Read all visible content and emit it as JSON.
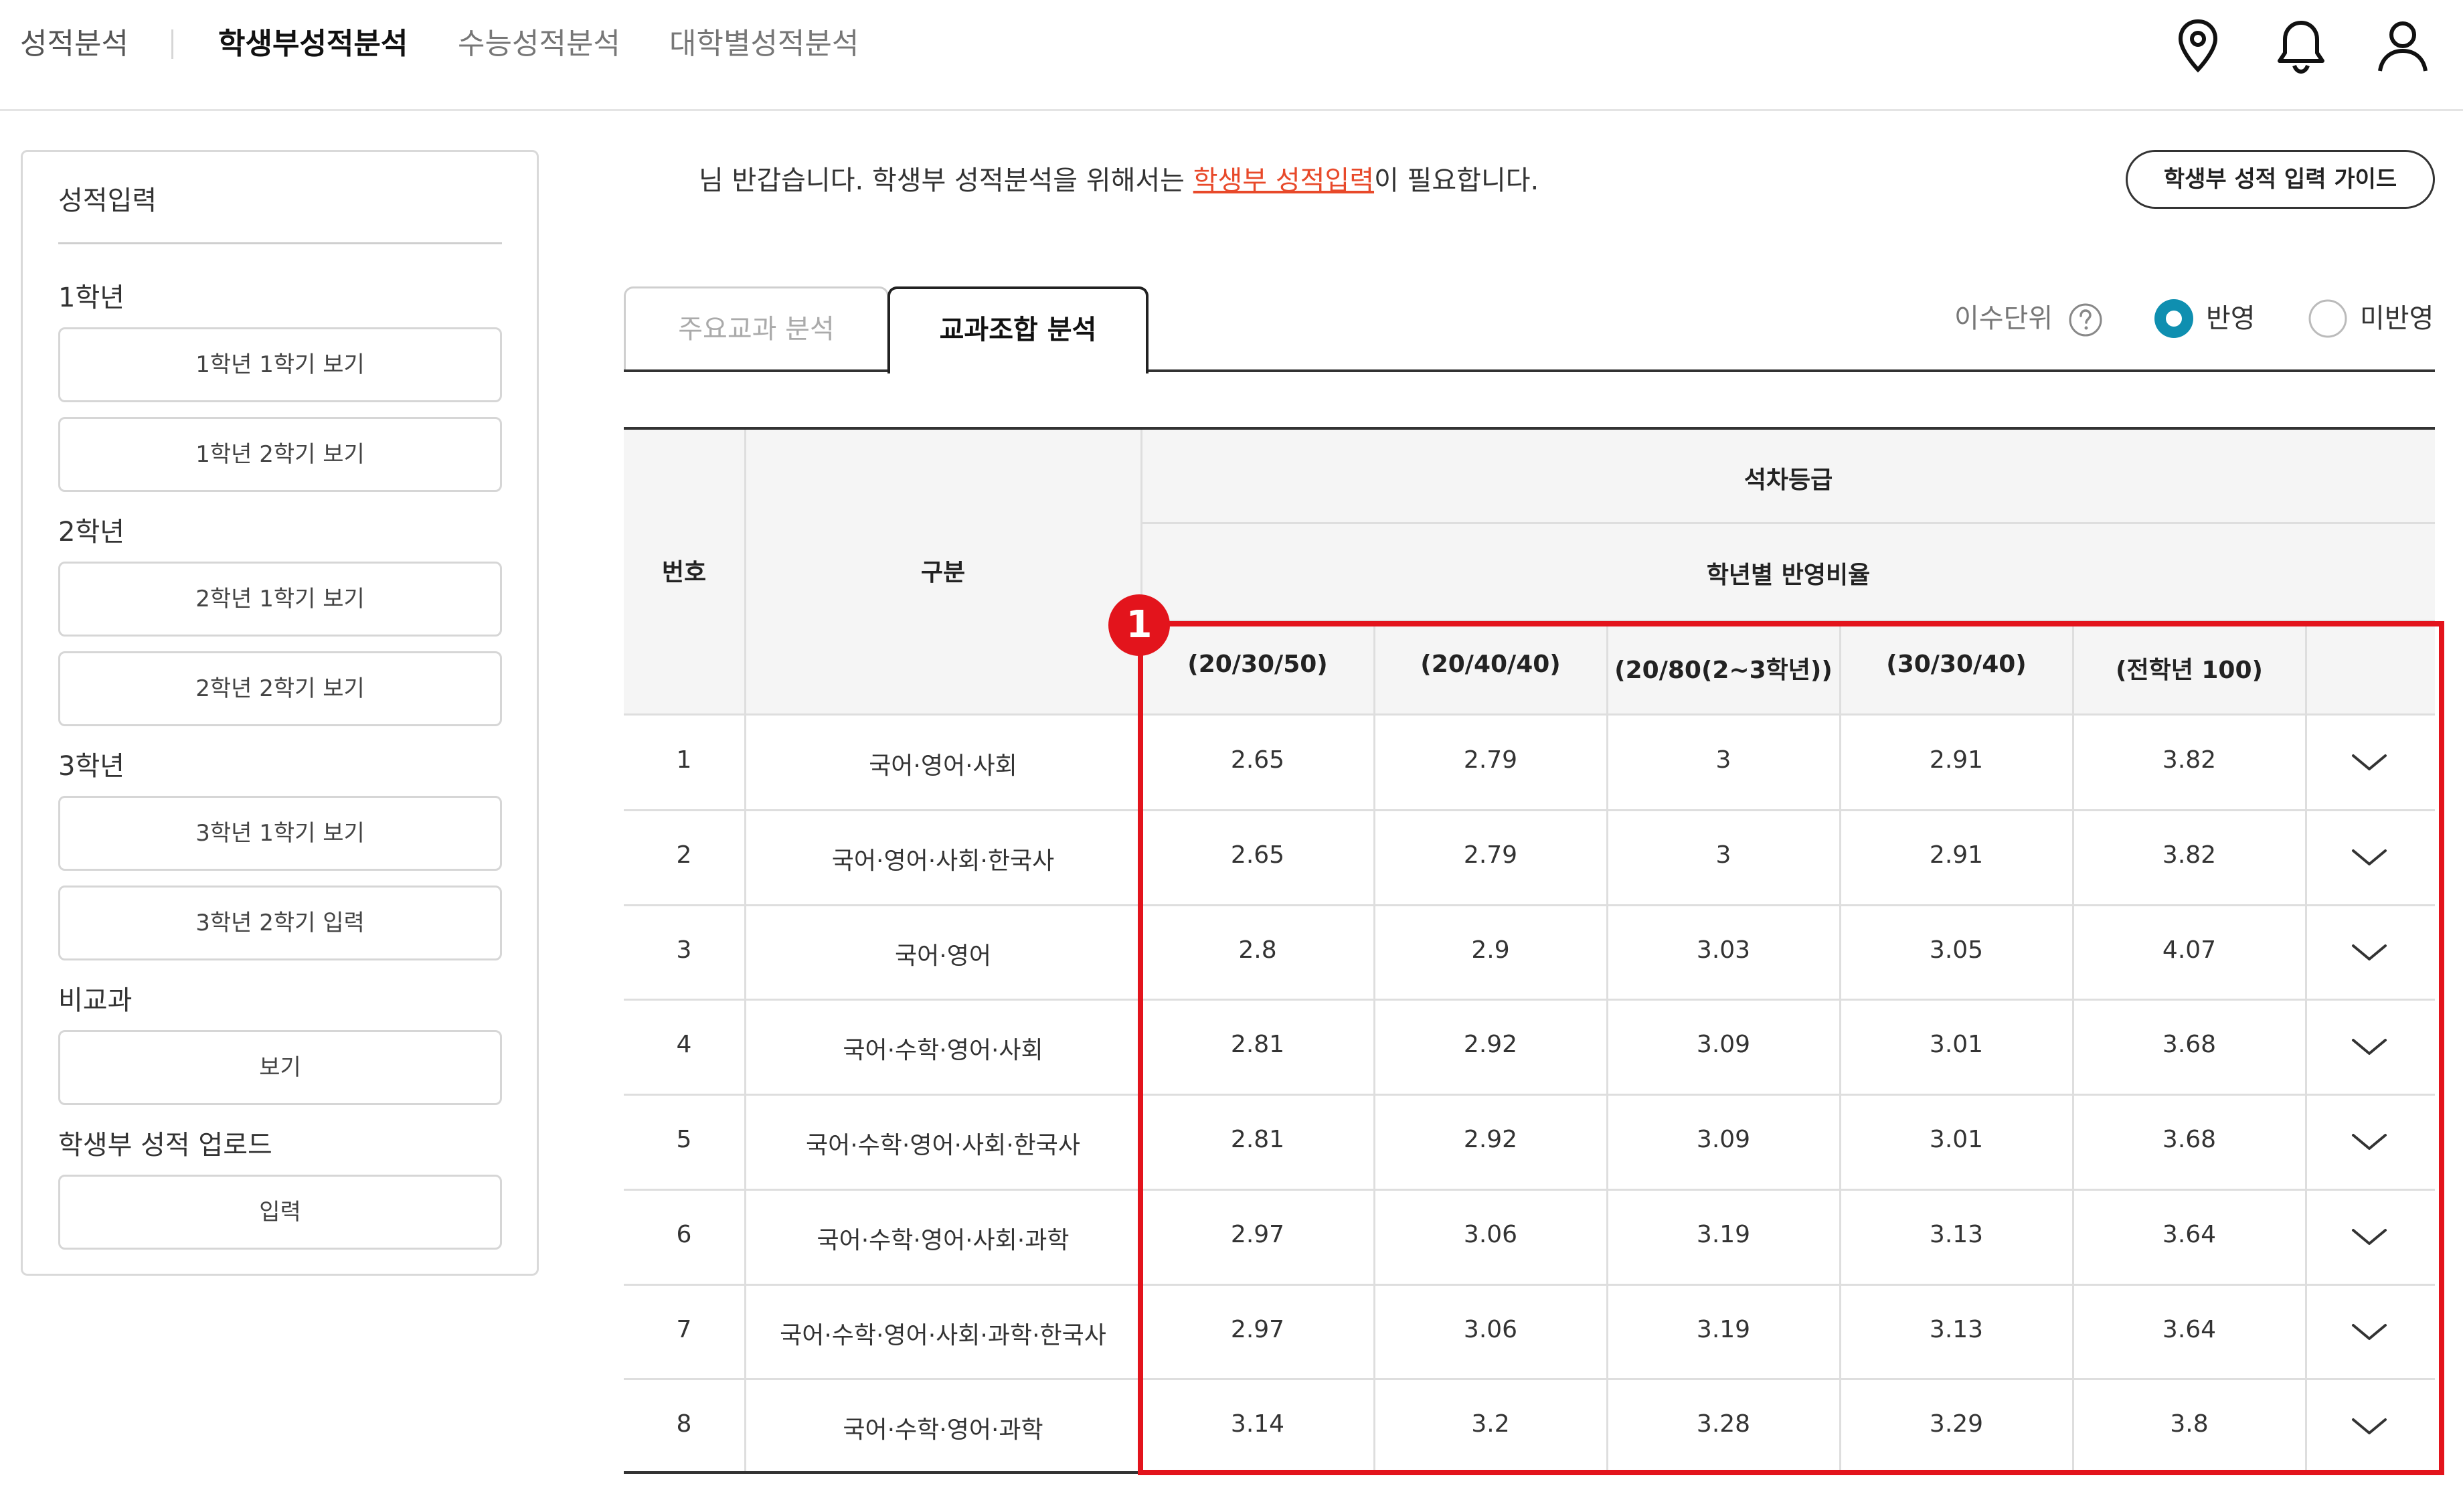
{
  "nav": {
    "brand": "성적분석",
    "items": [
      "학생부성적분석",
      "수능성적분석",
      "대학별성적분석"
    ],
    "active_index": 0
  },
  "icons": [
    "location-pin-icon",
    "bell-icon",
    "user-icon"
  ],
  "sidebar": {
    "title": "성적입력",
    "groups": [
      {
        "label": "1학년",
        "buttons": [
          "1학년 1학기 보기",
          "1학년 2학기 보기"
        ]
      },
      {
        "label": "2학년",
        "buttons": [
          "2학년 1학기 보기",
          "2학년 2학기 보기"
        ]
      },
      {
        "label": "3학년",
        "buttons": [
          "3학년 1학기 보기",
          "3학년 2학기 입력"
        ]
      },
      {
        "label": "비교과",
        "buttons": [
          "보기"
        ]
      },
      {
        "label": "학생부 성적 업로드",
        "buttons": [
          "입력"
        ]
      }
    ]
  },
  "welcome": {
    "prefix": "님 반갑습니다. 학생부 성적분석을 위해서는 ",
    "link": "학생부 성적입력",
    "suffix": "이 필요합니다."
  },
  "guide_button": "학생부 성적 입력 가이드",
  "tabs": [
    "주요교과 분석",
    "교과조합 분석"
  ],
  "active_tab": 1,
  "unit_option": {
    "label": "이수단위",
    "options": [
      "반영",
      "미반영"
    ],
    "selected": "반영"
  },
  "table": {
    "col_number": "번호",
    "col_category": "구분",
    "group_header": "석차등급",
    "sub_header": "학년별 반영비율",
    "ratio_headers": [
      "(20/30/50)",
      "(20/40/40)",
      "(20/80(2~3학년))",
      "(30/30/40)",
      "(전학년 100)"
    ],
    "rows": [
      {
        "no": "1",
        "category": "국어·영어·사회",
        "values": [
          "2.65",
          "2.79",
          "3",
          "2.91",
          "3.82"
        ]
      },
      {
        "no": "2",
        "category": "국어·영어·사회·한국사",
        "values": [
          "2.65",
          "2.79",
          "3",
          "2.91",
          "3.82"
        ]
      },
      {
        "no": "3",
        "category": "국어·영어",
        "values": [
          "2.8",
          "2.9",
          "3.03",
          "3.05",
          "4.07"
        ]
      },
      {
        "no": "4",
        "category": "국어·수학·영어·사회",
        "values": [
          "2.81",
          "2.92",
          "3.09",
          "3.01",
          "3.68"
        ]
      },
      {
        "no": "5",
        "category": "국어·수학·영어·사회·한국사",
        "values": [
          "2.81",
          "2.92",
          "3.09",
          "3.01",
          "3.68"
        ]
      },
      {
        "no": "6",
        "category": "국어·수학·영어·사회·과학",
        "values": [
          "2.97",
          "3.06",
          "3.19",
          "3.13",
          "3.64"
        ]
      },
      {
        "no": "7",
        "category": "국어·수학·영어·사회·과학·한국사",
        "values": [
          "2.97",
          "3.06",
          "3.19",
          "3.13",
          "3.64"
        ]
      },
      {
        "no": "8",
        "category": "국어·수학·영어·과학",
        "values": [
          "3.14",
          "3.2",
          "3.28",
          "3.29",
          "3.8"
        ]
      }
    ],
    "row_toggle_icon": "chevron-down-icon"
  },
  "annotation": {
    "badge": "1",
    "color": "#e3141c"
  },
  "colors": {
    "accent": "#0f8fb0",
    "link": "#e8492a"
  }
}
